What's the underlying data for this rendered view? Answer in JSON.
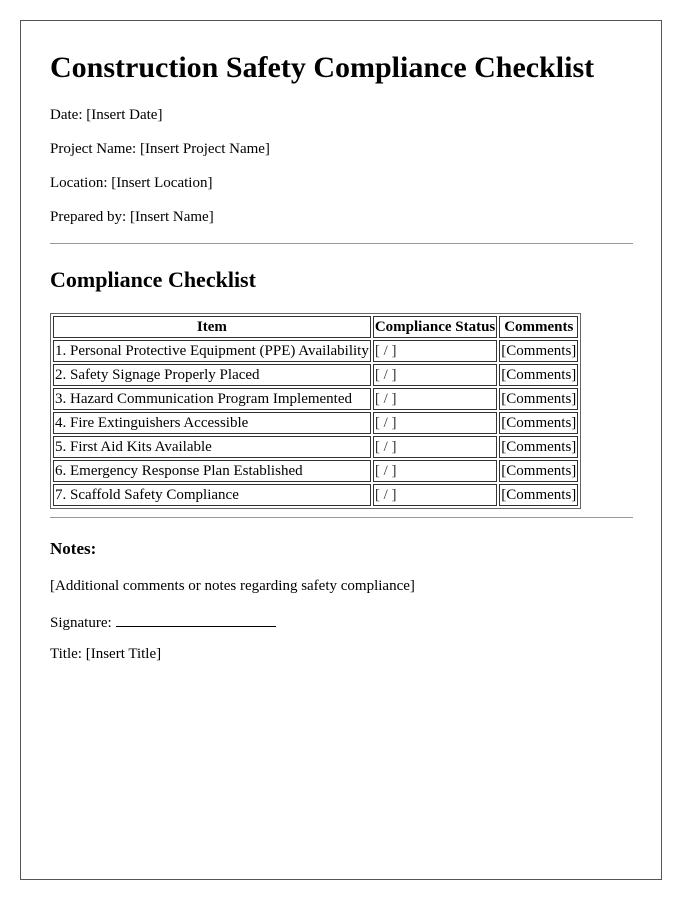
{
  "document": {
    "title": "Construction Safety Compliance Checklist",
    "meta": [
      {
        "label": "Date:",
        "value": "[Insert Date]"
      },
      {
        "label": "Project Name:",
        "value": "[Insert Project Name]"
      },
      {
        "label": "Location:",
        "value": "[Insert Location]"
      },
      {
        "label": "Prepared by:",
        "value": "[Insert Name]"
      }
    ],
    "checklist_heading": "Compliance Checklist",
    "table": {
      "headers": [
        "Item",
        "Compliance Status",
        "Comments"
      ],
      "rows": [
        {
          "item": "1. Personal Protective Equipment (PPE) Availability",
          "status": "[ / ]",
          "comments": "[Comments]"
        },
        {
          "item": "2. Safety Signage Properly Placed",
          "status": "[ / ]",
          "comments": "[Comments]"
        },
        {
          "item": "3. Hazard Communication Program Implemented",
          "status": "[ / ]",
          "comments": "[Comments]"
        },
        {
          "item": "4. Fire Extinguishers Accessible",
          "status": "[ / ]",
          "comments": "[Comments]"
        },
        {
          "item": "5. First Aid Kits Available",
          "status": "[ / ]",
          "comments": "[Comments]"
        },
        {
          "item": "6. Emergency Response Plan Established",
          "status": "[ / ]",
          "comments": "[Comments]"
        },
        {
          "item": "7. Scaffold Safety Compliance",
          "status": "[ / ]",
          "comments": "[Comments]"
        }
      ]
    },
    "notes_heading": "Notes:",
    "notes_text": "[Additional comments or notes regarding safety compliance]",
    "signature_label": "Signature:",
    "title_label": "Title: [Insert Title]"
  }
}
